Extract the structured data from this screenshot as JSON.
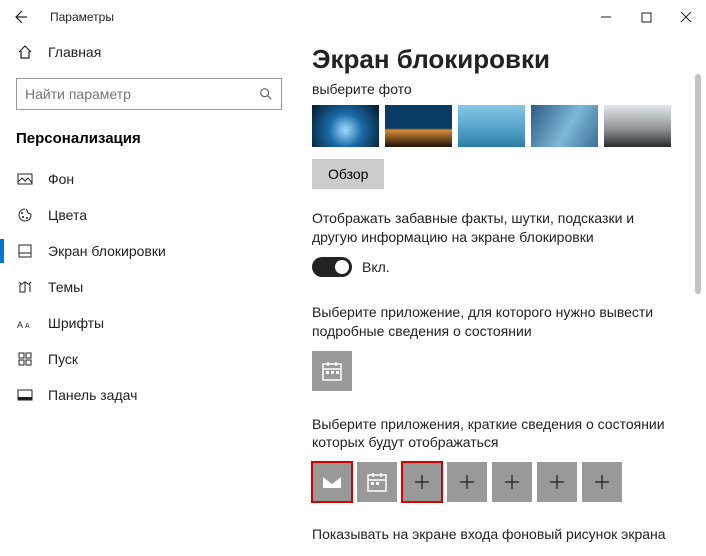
{
  "titlebar": {
    "title": "Параметры"
  },
  "sidebar": {
    "home": "Главная",
    "search_placeholder": "Найти параметр",
    "category": "Персонализация",
    "items": [
      {
        "label": "Фон"
      },
      {
        "label": "Цвета"
      },
      {
        "label": "Экран блокировки"
      },
      {
        "label": "Темы"
      },
      {
        "label": "Шрифты"
      },
      {
        "label": "Пуск"
      },
      {
        "label": "Панель задач"
      }
    ]
  },
  "content": {
    "heading": "Экран блокировки",
    "choose_photo": "выберите фото",
    "browse": "Обзор",
    "fun_facts_label": "Отображать забавные факты, шутки, подсказки и другую информацию на экране блокировки",
    "toggle_on": "Вкл.",
    "detailed_app_label": "Выберите приложение, для которого нужно вывести подробные сведения о состоянии",
    "quick_apps_label": "Выберите приложения, краткие сведения о состоянии которых будут отображаться",
    "bottom_cut": "Показывать на экране входа фоновый рисунок экрана"
  }
}
